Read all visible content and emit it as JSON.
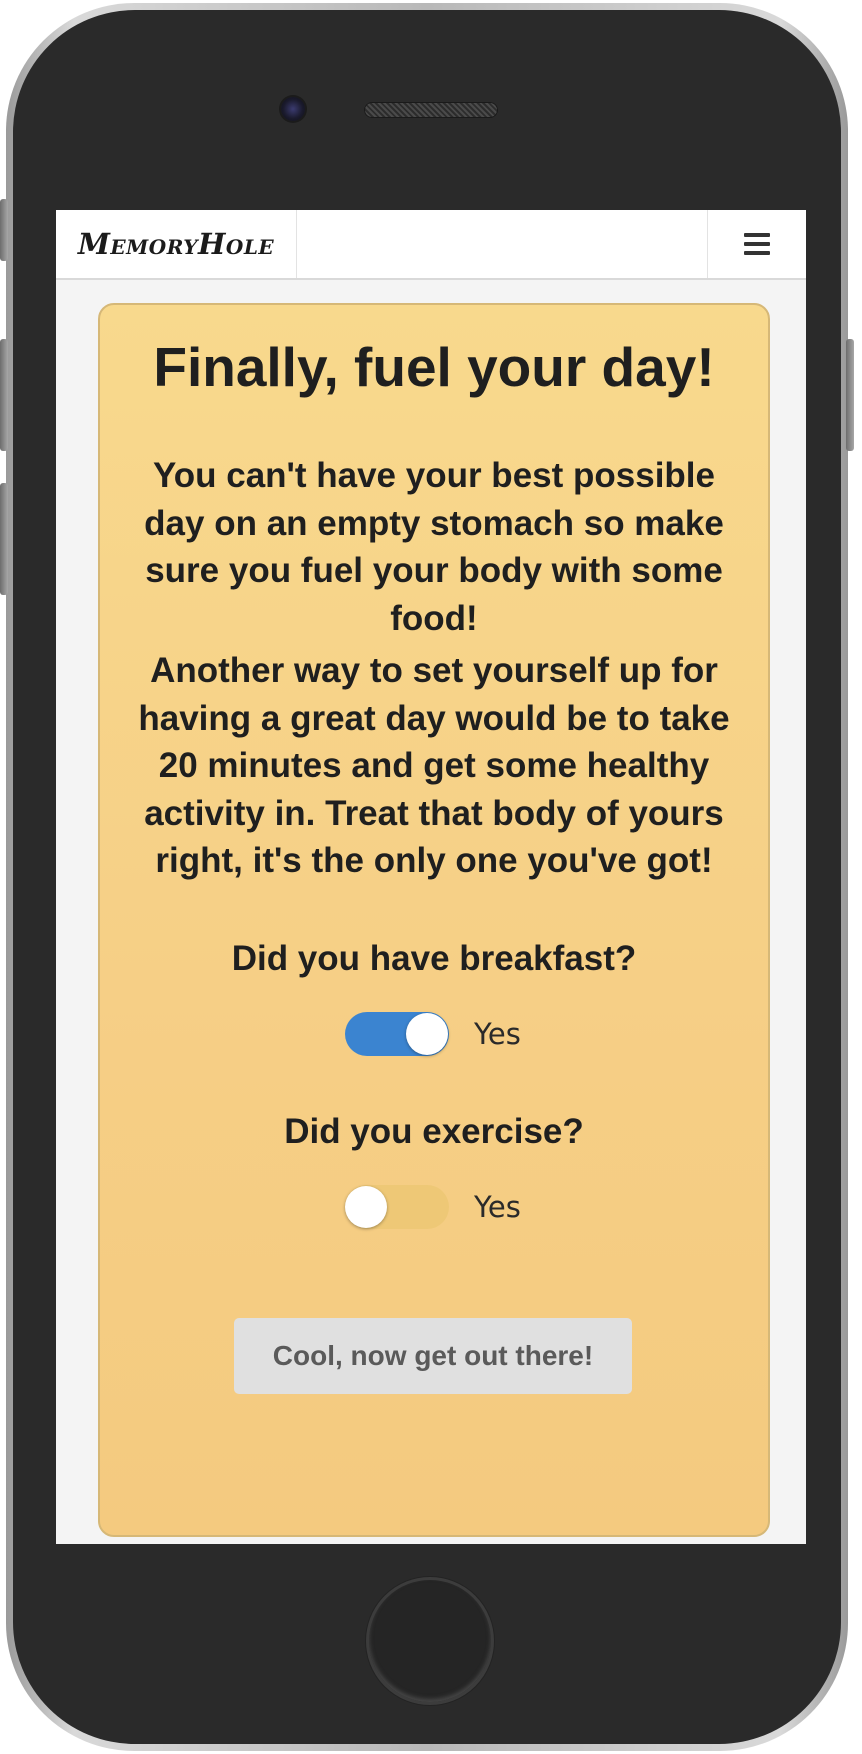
{
  "app": {
    "brand": "MemoryHole"
  },
  "navbar": {
    "menu_icon": "hamburger-menu-icon"
  },
  "card": {
    "title": "Finally, fuel your day!",
    "paragraph_1": "You can't have your best possible day on an empty stomach so make sure you fuel your body with some food!",
    "paragraph_2": "Another way to set yourself up for having a great day would be to take 20 minutes and get some healthy activity in. Treat that body of yours right, it's the only one you've got!",
    "questions": [
      {
        "label": "Did you have breakfast?",
        "toggle_label": "Yes",
        "checked": true
      },
      {
        "label": "Did you exercise?",
        "toggle_label": "Yes",
        "checked": false
      }
    ],
    "button_label": "Cool, now get out there!"
  },
  "colors": {
    "card_background": "#f7d38a",
    "toggle_on": "#3b84d0",
    "toggle_off": "#eec876",
    "button_background": "#e0e0e0"
  }
}
